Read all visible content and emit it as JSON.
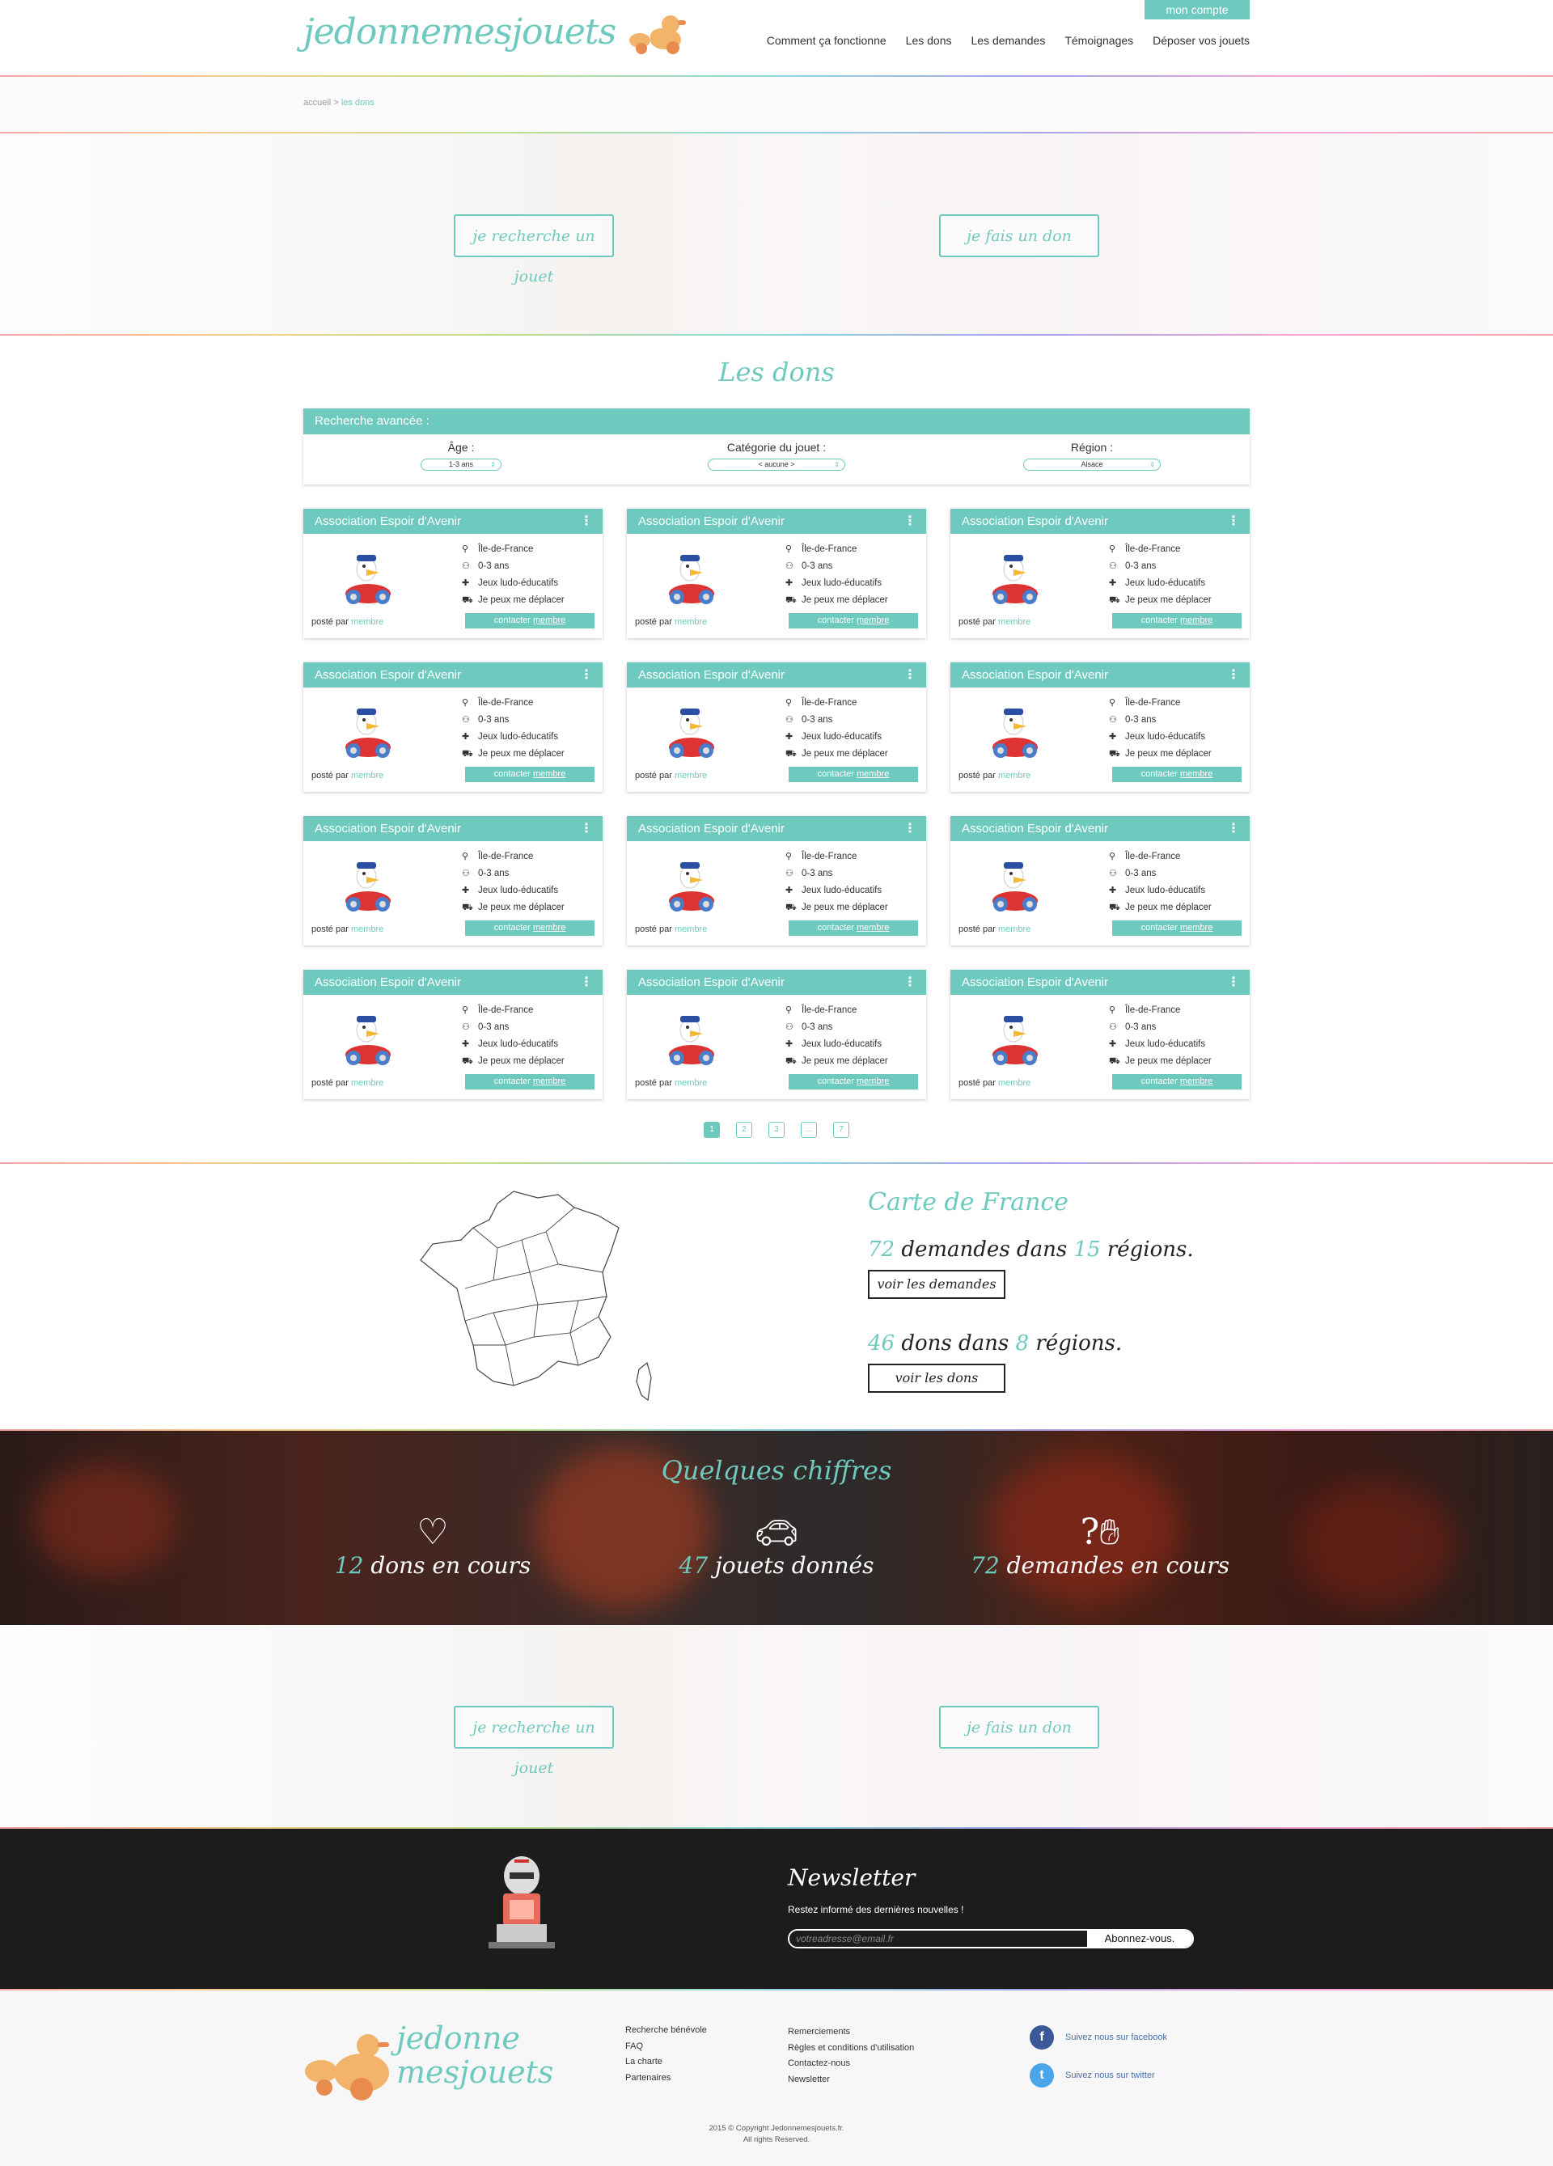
{
  "header": {
    "logo": "jedonnemesjouets",
    "account_button": "mon compte",
    "nav": [
      "Comment ça fonctionne",
      "Les dons",
      "Les demandes",
      "Témoignages",
      "Déposer vos jouets"
    ]
  },
  "breadcrumb": {
    "home": "accueil",
    "separator": ">",
    "current": "les dons"
  },
  "hero": {
    "search_button": "je recherche un jouet",
    "donate_button": "je fais un don"
  },
  "dons": {
    "title": "Les dons",
    "search": {
      "header": "Recherche avancée :",
      "age_label": "Âge :",
      "age_value": "1-3 ans",
      "category_label": "Catégorie du jouet :",
      "category_value": "< aucune >",
      "region_label": "Région :",
      "region_value": "Alsace"
    },
    "card": {
      "title": "Association Espoir d'Avenir",
      "region": "Île-de-France",
      "age": "0-3 ans",
      "category": "Jeux ludo-éducatifs",
      "mobility": "Je peux me déplacer",
      "posted_by": "posté par",
      "member": "membre",
      "contact": "contacter",
      "contact_member": "membre"
    },
    "pagination": [
      "1",
      "2",
      "3",
      "...",
      "7"
    ]
  },
  "map": {
    "title": "Carte de France",
    "demandes_count": "72",
    "demandes_text": "demandes dans",
    "demandes_regions": "15",
    "demandes_suffix": "régions.",
    "demandes_button": "voir les demandes",
    "dons_count": "46",
    "dons_text": "dons dans",
    "dons_regions": "8",
    "dons_suffix": "régions.",
    "dons_button": "voir les dons"
  },
  "chiffres": {
    "title": "Quelques chiffres",
    "items": [
      {
        "number": "12",
        "label": "dons en cours",
        "icon": "heart-hand-icon"
      },
      {
        "number": "47",
        "label": "jouets donnés",
        "icon": "car-icon"
      },
      {
        "number": "72",
        "label": "demandes en cours",
        "icon": "question-hand-icon"
      }
    ]
  },
  "hero_bottom": {
    "search_button": "je recherche un jouet",
    "donate_button": "je fais un don"
  },
  "newsletter": {
    "title": "Newsletter",
    "subtitle": "Restez informé des dernières nouvelles !",
    "placeholder": "votreadresse@email.fr",
    "button": "Abonnez-vous."
  },
  "footer": {
    "logo_line1": "jedonne",
    "logo_line2": "mesjouets",
    "col1": [
      "Recherche bénévole",
      "FAQ",
      "La charte",
      "Partenaires"
    ],
    "col2": [
      "Remerciements",
      "Règles et conditions d'utilisation",
      "Contactez-nous",
      "Newsletter"
    ],
    "facebook": "Suivez nous sur facebook",
    "twitter": "Suivez nous sur twitter",
    "copyright_line1": "2015 © Copyright Jedonnemesjouets.fr.",
    "copyright_line2": "All rights Reserved."
  },
  "colors": {
    "accent": "#6ec9be",
    "dark": "#1c1c1d"
  }
}
